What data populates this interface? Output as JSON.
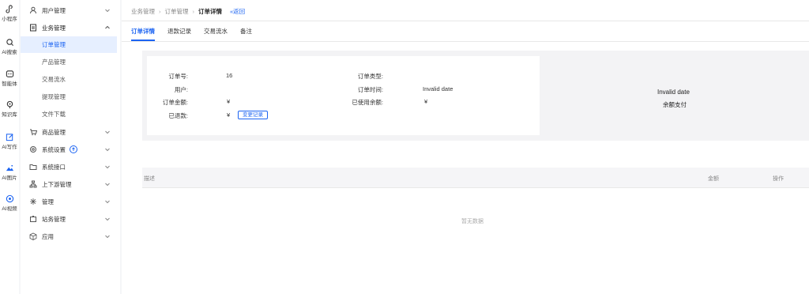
{
  "rail": [
    {
      "icon": "mini-program-icon",
      "label": "小程序"
    },
    {
      "icon": "ai-search-icon",
      "label": "AI搜索"
    },
    {
      "icon": "agent-icon",
      "label": "智能体"
    },
    {
      "icon": "knowledge-base-icon",
      "label": "知识库"
    },
    {
      "icon": "ai-writing-icon",
      "label": "AI写作"
    },
    {
      "icon": "ai-image-icon",
      "label": "AI图片"
    },
    {
      "icon": "ai-video-icon",
      "label": "AI视频"
    }
  ],
  "sidebar": {
    "user_mgmt": "用户管理",
    "business_mgmt": "业务管理",
    "sub": {
      "order_mgmt": "订单管理",
      "product_mgmt": "产品管理",
      "transactions": "交易流水",
      "withdraw_mgmt": "提现管理",
      "file_download": "文件下载"
    },
    "goods_mgmt": "商品管理",
    "system_settings": "系统设置",
    "system_api": "系统接口",
    "upstream_mgmt": "上下游管理",
    "manage": "管理",
    "site_mgmt": "站务管理",
    "apps": "应用"
  },
  "breadcrumb": {
    "level1": "业务管理",
    "level2": "订单管理",
    "current": "订单详情",
    "back": "«返回"
  },
  "tabs": {
    "order_detail": "订单详情",
    "refund_records": "退款记录",
    "transactions": "交易流水",
    "remarks": "备注"
  },
  "order": {
    "order_no_label": "订单号:",
    "order_no": "16",
    "user_label": "用户:",
    "amount_label": "订单金额:",
    "amount": "¥",
    "refunded_label": "已退款:",
    "refunded": "¥",
    "change_btn": "变更记录",
    "type_label": "订单类型:",
    "time_label": "订单时间:",
    "time": "Invalid date",
    "balance_used_label": "已使用余额:",
    "balance_used": "¥",
    "right_date": "Invalid date",
    "pay_type": "余额支付"
  },
  "table": {
    "col_desc": "描述",
    "col_amount": "金额",
    "col_ops": "操作",
    "empty": "暂无数据"
  }
}
